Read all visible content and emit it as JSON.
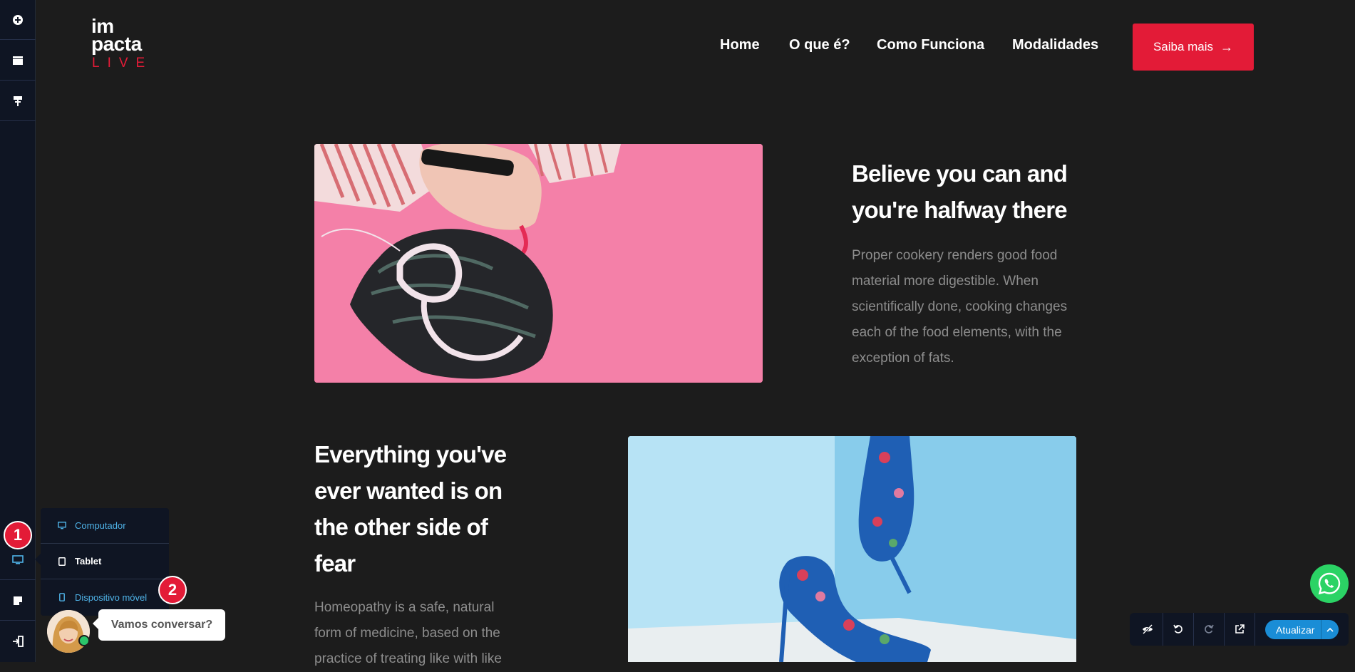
{
  "logo": {
    "line1": "im",
    "line2": "pacta",
    "line3": "LIVE"
  },
  "nav": {
    "home": "Home",
    "o_que_e": "O que é?",
    "como_funciona": "Como Funciona",
    "modalidades": "Modalidades"
  },
  "cta": {
    "label": "Saiba mais",
    "arrow": "→"
  },
  "sections": {
    "first": {
      "heading_line1": "Believe you can and",
      "heading_line2": "you're halfway there",
      "paragraph_lines": [
        "Proper cookery renders good food",
        "material more digestible. When",
        "scientifically done, cooking changes",
        "each of the food elements, with the",
        "exception of fats."
      ]
    },
    "second": {
      "heading_lines": [
        "Everything you've",
        "ever wanted is on",
        "the other side of",
        "fear"
      ],
      "paragraph_lines": [
        "Homeopathy is a safe, natural",
        "form of medicine, based on the",
        "practice of treating like with like"
      ]
    }
  },
  "device_menu": {
    "desktop": "Computador",
    "tablet": "Tablet",
    "mobile": "Dispositivo móvel"
  },
  "badges": {
    "one": "1",
    "two": "2"
  },
  "chat": {
    "bubble": "Vamos conversar?"
  },
  "toolbar": {
    "update_label": "Atualizar"
  },
  "colors": {
    "accent": "#e31b37",
    "sidebar": "#0f1523",
    "page_bg": "#1c1c1c",
    "link_blue": "#4fb3e8",
    "update_blue": "#1a8dd6",
    "whatsapp": "#2bd365"
  },
  "icons": {
    "sidebar": [
      "plus-circle-icon",
      "layout-icon",
      "paint-roller-icon",
      "desktop-icon",
      "note-icon",
      "exit-icon"
    ],
    "toolbar": [
      "eye-off-icon",
      "undo-icon",
      "redo-icon",
      "external-link-icon",
      "chevron-up-icon"
    ],
    "other": [
      "whatsapp-icon",
      "arrow-right-icon"
    ]
  }
}
